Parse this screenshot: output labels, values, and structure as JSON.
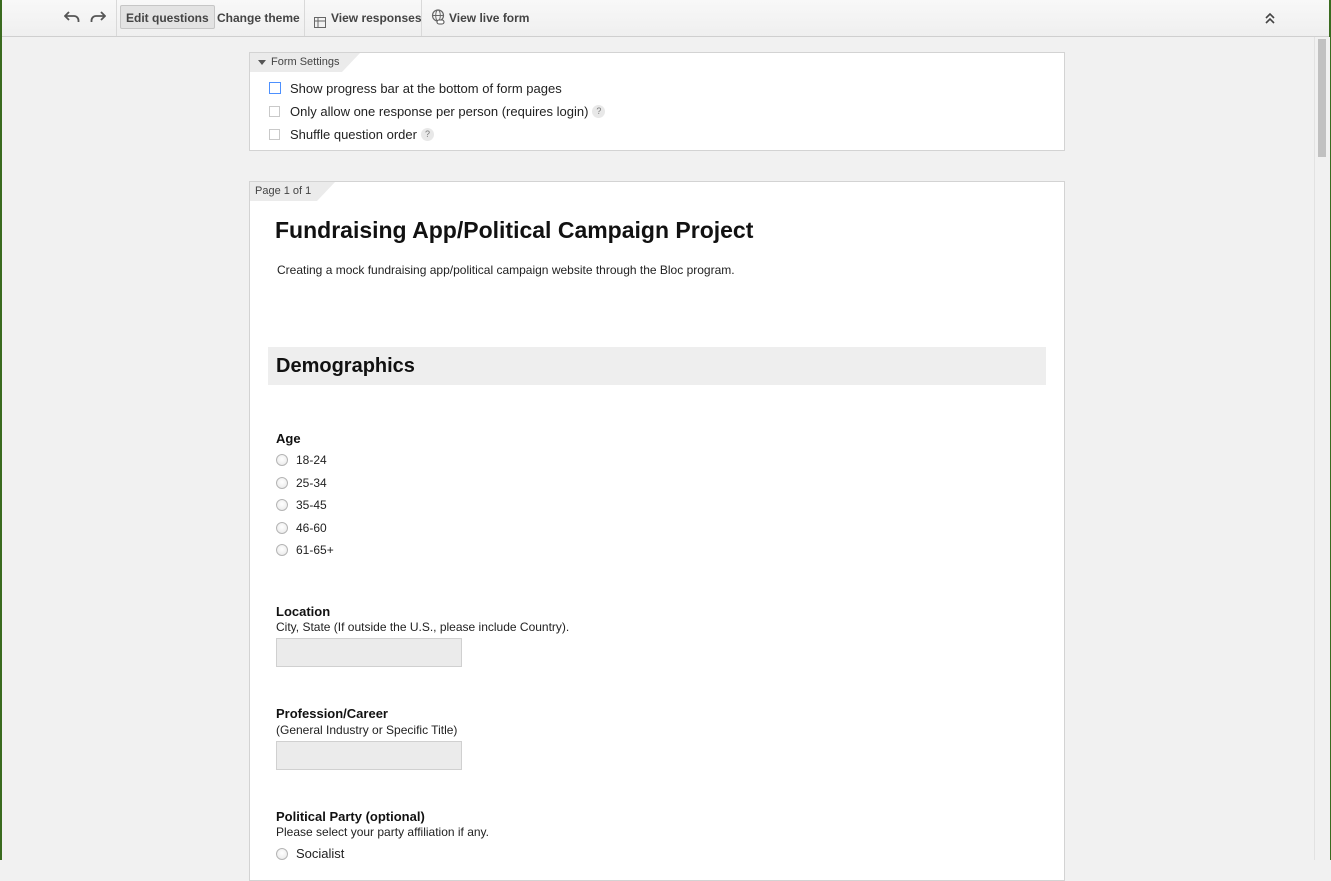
{
  "toolbar": {
    "undo_icon": "undo-icon",
    "redo_icon": "redo-icon",
    "edit_questions": "Edit questions",
    "change_theme": "Change theme",
    "view_responses": "View responses",
    "view_live_form": "View live form",
    "collapse_icon": "double-chevron-up-icon"
  },
  "settings": {
    "tab": "Form Settings",
    "options": [
      {
        "label": "Show progress bar at the bottom of form pages",
        "checked": false
      },
      {
        "label": "Only allow one response per person (requires login)",
        "checked": false
      },
      {
        "label": "Shuffle question order",
        "checked": false
      }
    ],
    "help_glyph": "?"
  },
  "page": {
    "tab": "Page 1 of 1",
    "title": "Fundraising App/Political Campaign Project",
    "description": "Creating a mock fundraising app/political campaign website through the Bloc program."
  },
  "section": {
    "title": "Demographics"
  },
  "questions": {
    "age": {
      "title": "Age",
      "options": [
        "18-24",
        "25-34",
        "35-45",
        "46-60",
        "61-65+"
      ]
    },
    "location": {
      "title": "Location",
      "help": "City, State (If outside the U.S., please include Country).",
      "value": ""
    },
    "profession": {
      "title": "Profession/Career",
      "help": "(General Industry or Specific Title)",
      "value": ""
    },
    "party": {
      "title": "Political Party (optional)",
      "help": "Please select your party affiliation if any.",
      "options": [
        "Socialist"
      ]
    }
  },
  "colors": {
    "toolbar_bg": "#f5f5f5",
    "page_bg": "#f1f1f1",
    "section_bg": "#eeeeee",
    "focus_border": "#4d90fe"
  }
}
